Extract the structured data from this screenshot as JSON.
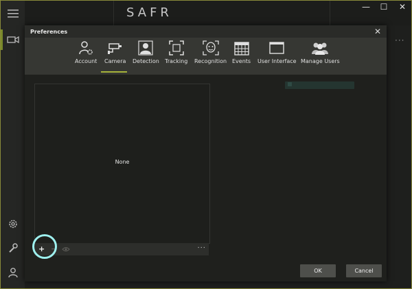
{
  "app": {
    "brand": "SAFR"
  },
  "window_controls": {
    "minimize": "—",
    "maximize": "☐",
    "close": "✕"
  },
  "background": {
    "more": "···"
  },
  "dialog": {
    "title": "Preferences",
    "close": "✕",
    "tabs": [
      {
        "label": "Account",
        "icon": "account-settings-icon"
      },
      {
        "label": "Camera",
        "icon": "camera-icon",
        "selected": true
      },
      {
        "label": "Detection",
        "icon": "detection-icon"
      },
      {
        "label": "Tracking",
        "icon": "tracking-icon"
      },
      {
        "label": "Recognition",
        "icon": "recognition-icon"
      },
      {
        "label": "Events",
        "icon": "calendar-icon"
      },
      {
        "label": "User Interface",
        "icon": "window-icon"
      },
      {
        "label": "Manage Users",
        "icon": "users-icon"
      }
    ],
    "camera_list": {
      "empty_text": "None",
      "add": "+",
      "remove": "−",
      "more": "···"
    },
    "ok_label": "OK",
    "cancel_label": "Cancel"
  },
  "colors": {
    "accent": "#a6b33a",
    "highlight": "#9ef0ee",
    "dialog_bg": "#2a2b28"
  }
}
